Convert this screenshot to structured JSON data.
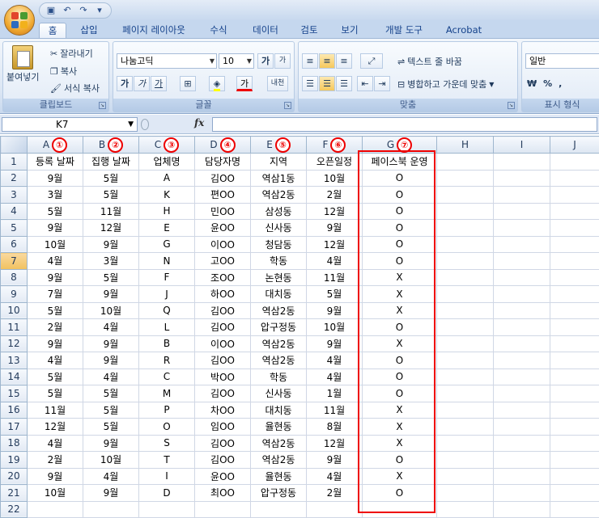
{
  "quick_access": {
    "save_icon": "save-icon",
    "undo_icon": "undo-icon",
    "redo_icon": "redo-icon"
  },
  "ribbon_tabs": [
    "홈",
    "삽입",
    "페이지 레이아웃",
    "수식",
    "데이터",
    "검토",
    "보기",
    "개발 도구",
    "Acrobat"
  ],
  "active_tab": "홈",
  "clipboard": {
    "paste": "붙여넣기",
    "cut": "잘라내기",
    "copy": "복사",
    "format_painter": "서식 복사",
    "label": "클립보드"
  },
  "font": {
    "name": "나눔고딕",
    "size": "10",
    "grow": "가",
    "shrink": "가",
    "bold": "가",
    "italic": "가",
    "underline": "가",
    "font_color": "가",
    "phonetic": "내천",
    "label": "글꼴"
  },
  "alignment": {
    "wrap_text": "텍스트 줄 바꿈",
    "merge_center": "병합하고 가운데 맞춤",
    "label": "맞춤"
  },
  "number": {
    "format": "일반",
    "currency": "₩",
    "percent": "%",
    "comma": ",",
    "label": "표시 형식"
  },
  "name_box": "K7",
  "fx_label": "fx",
  "columns": [
    "A",
    "B",
    "C",
    "D",
    "E",
    "F",
    "G",
    "H",
    "I",
    "J"
  ],
  "column_markers": [
    "①",
    "②",
    "③",
    "④",
    "⑤",
    "⑥",
    "⑦"
  ],
  "headers": [
    "등록 날짜",
    "집행 날짜",
    "업체명",
    "담당자명",
    "지역",
    "오픈일정",
    "페이스북 운영"
  ],
  "rows": [
    [
      "9월",
      "5월",
      "A",
      "김OO",
      "역삼1동",
      "10월",
      "O"
    ],
    [
      "3월",
      "5월",
      "K",
      "편OO",
      "역삼2동",
      "2월",
      "O"
    ],
    [
      "5월",
      "11월",
      "H",
      "민OO",
      "삼성동",
      "12월",
      "O"
    ],
    [
      "9월",
      "12월",
      "E",
      "윤OO",
      "신사동",
      "9월",
      "O"
    ],
    [
      "10월",
      "9월",
      "G",
      "이OO",
      "청담동",
      "12월",
      "O"
    ],
    [
      "4월",
      "3월",
      "N",
      "고OO",
      "학동",
      "4월",
      "O"
    ],
    [
      "9월",
      "5월",
      "F",
      "조OO",
      "논현동",
      "11월",
      "X"
    ],
    [
      "7월",
      "9월",
      "J",
      "하OO",
      "대치동",
      "5월",
      "X"
    ],
    [
      "5월",
      "10월",
      "Q",
      "김OO",
      "역삼2동",
      "9월",
      "X"
    ],
    [
      "2월",
      "4월",
      "L",
      "김OO",
      "압구정동",
      "10월",
      "O"
    ],
    [
      "9월",
      "9월",
      "B",
      "이OO",
      "역삼2동",
      "9월",
      "X"
    ],
    [
      "4월",
      "9월",
      "R",
      "김OO",
      "역삼2동",
      "4월",
      "O"
    ],
    [
      "5월",
      "4월",
      "C",
      "박OO",
      "학동",
      "4월",
      "O"
    ],
    [
      "5월",
      "5월",
      "M",
      "김OO",
      "신사동",
      "1월",
      "O"
    ],
    [
      "11월",
      "5월",
      "P",
      "차OO",
      "대치동",
      "11월",
      "X"
    ],
    [
      "12월",
      "5월",
      "O",
      "임OO",
      "율현동",
      "8월",
      "X"
    ],
    [
      "4월",
      "9월",
      "S",
      "김OO",
      "역삼2동",
      "12월",
      "X"
    ],
    [
      "2월",
      "10월",
      "T",
      "김OO",
      "역삼2동",
      "9월",
      "O"
    ],
    [
      "9월",
      "4월",
      "I",
      "윤OO",
      "율현동",
      "4월",
      "X"
    ],
    [
      "10월",
      "9월",
      "D",
      "최OO",
      "압구정동",
      "2월",
      "O"
    ]
  ],
  "row_numbers": [
    "1",
    "2",
    "3",
    "4",
    "5",
    "6",
    "7",
    "8",
    "9",
    "10",
    "11",
    "12",
    "13",
    "14",
    "15",
    "16",
    "17",
    "18",
    "19",
    "20",
    "21",
    "22"
  ],
  "selected_row": "7"
}
